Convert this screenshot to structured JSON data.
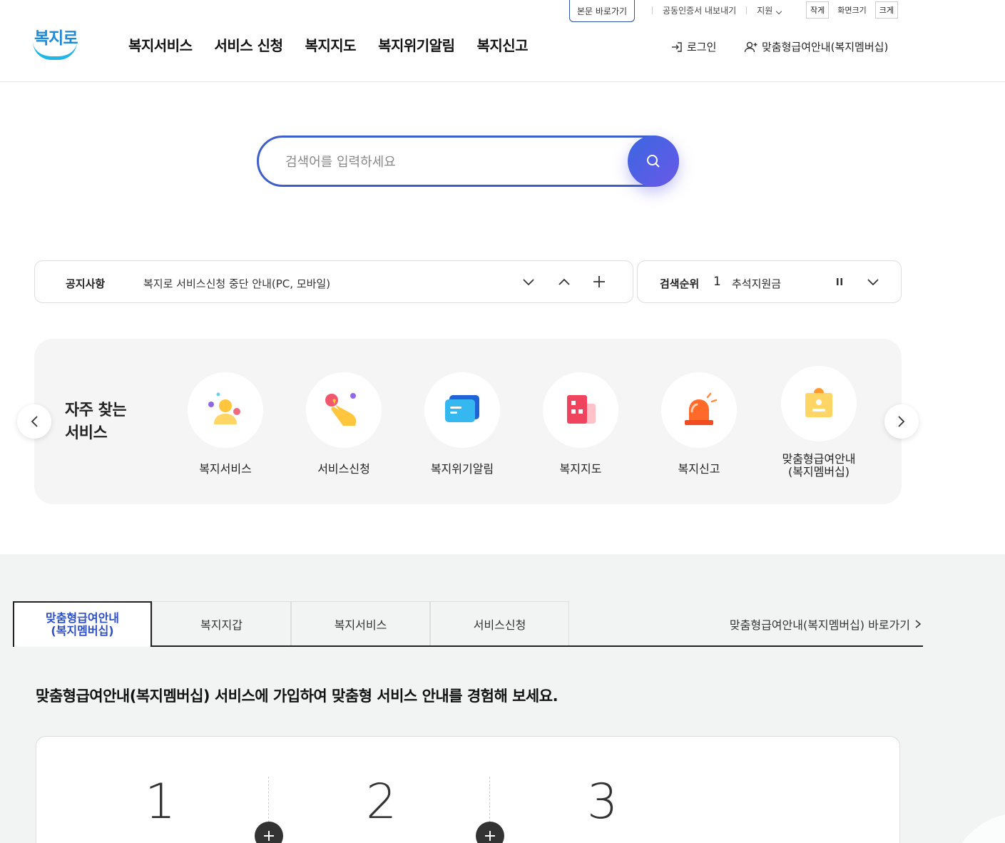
{
  "utility": {
    "skip_link": "본문 바로가기",
    "cert_export": "공동인증서 내보내기",
    "support": "지원",
    "font_small": "작게",
    "font_label": "화면크기",
    "font_large": "크게"
  },
  "header": {
    "logo_text": "복지로",
    "nav": [
      "복지서비스",
      "서비스 신청",
      "복지지도",
      "복지위기알림",
      "복지신고"
    ],
    "login": "로그인",
    "membership": "맞춤형급여안내(복지멤버십)"
  },
  "search": {
    "placeholder": "검색어를 입력하세요"
  },
  "notice": {
    "label": "공지사항",
    "text": "복지로 서비스신청 중단 안내(PC, 모바일)"
  },
  "ranking": {
    "label": "검색순위",
    "rank": "1",
    "keyword": "추석지원금"
  },
  "frequent": {
    "title_line1": "자주 찾는",
    "title_line2": "서비스",
    "items": [
      {
        "label": "복지서비스",
        "icon": "person-icon"
      },
      {
        "label": "서비스신청",
        "icon": "hand-pointer-icon"
      },
      {
        "label": "복지위기알림",
        "icon": "chat-bubble-icon"
      },
      {
        "label": "복지지도",
        "icon": "building-icon"
      },
      {
        "label": "복지신고",
        "icon": "siren-icon"
      },
      {
        "label_line1": "맞춤형급여안내",
        "label_line2": "(복지멤버십)",
        "icon": "id-card-icon"
      }
    ]
  },
  "tabs": {
    "items": [
      {
        "line1": "맞춤형급여안내",
        "line2": "(복지멤버십)"
      },
      {
        "label": "복지지갑"
      },
      {
        "label": "복지서비스"
      },
      {
        "label": "서비스신청"
      }
    ],
    "shortcut": "맞춤형급여안내(복지멤버십) 바로가기"
  },
  "intro": "맞춤형급여안내(복지멤버십) 서비스에 가입하여 맞춤형 서비스 안내를 경험해 보세요.",
  "steps": [
    "1",
    "2",
    "3"
  ],
  "colors": {
    "accent": "#3e5fc9",
    "logo_blue": "#1f8ad6",
    "panel_bg": "#f5f5f5"
  }
}
